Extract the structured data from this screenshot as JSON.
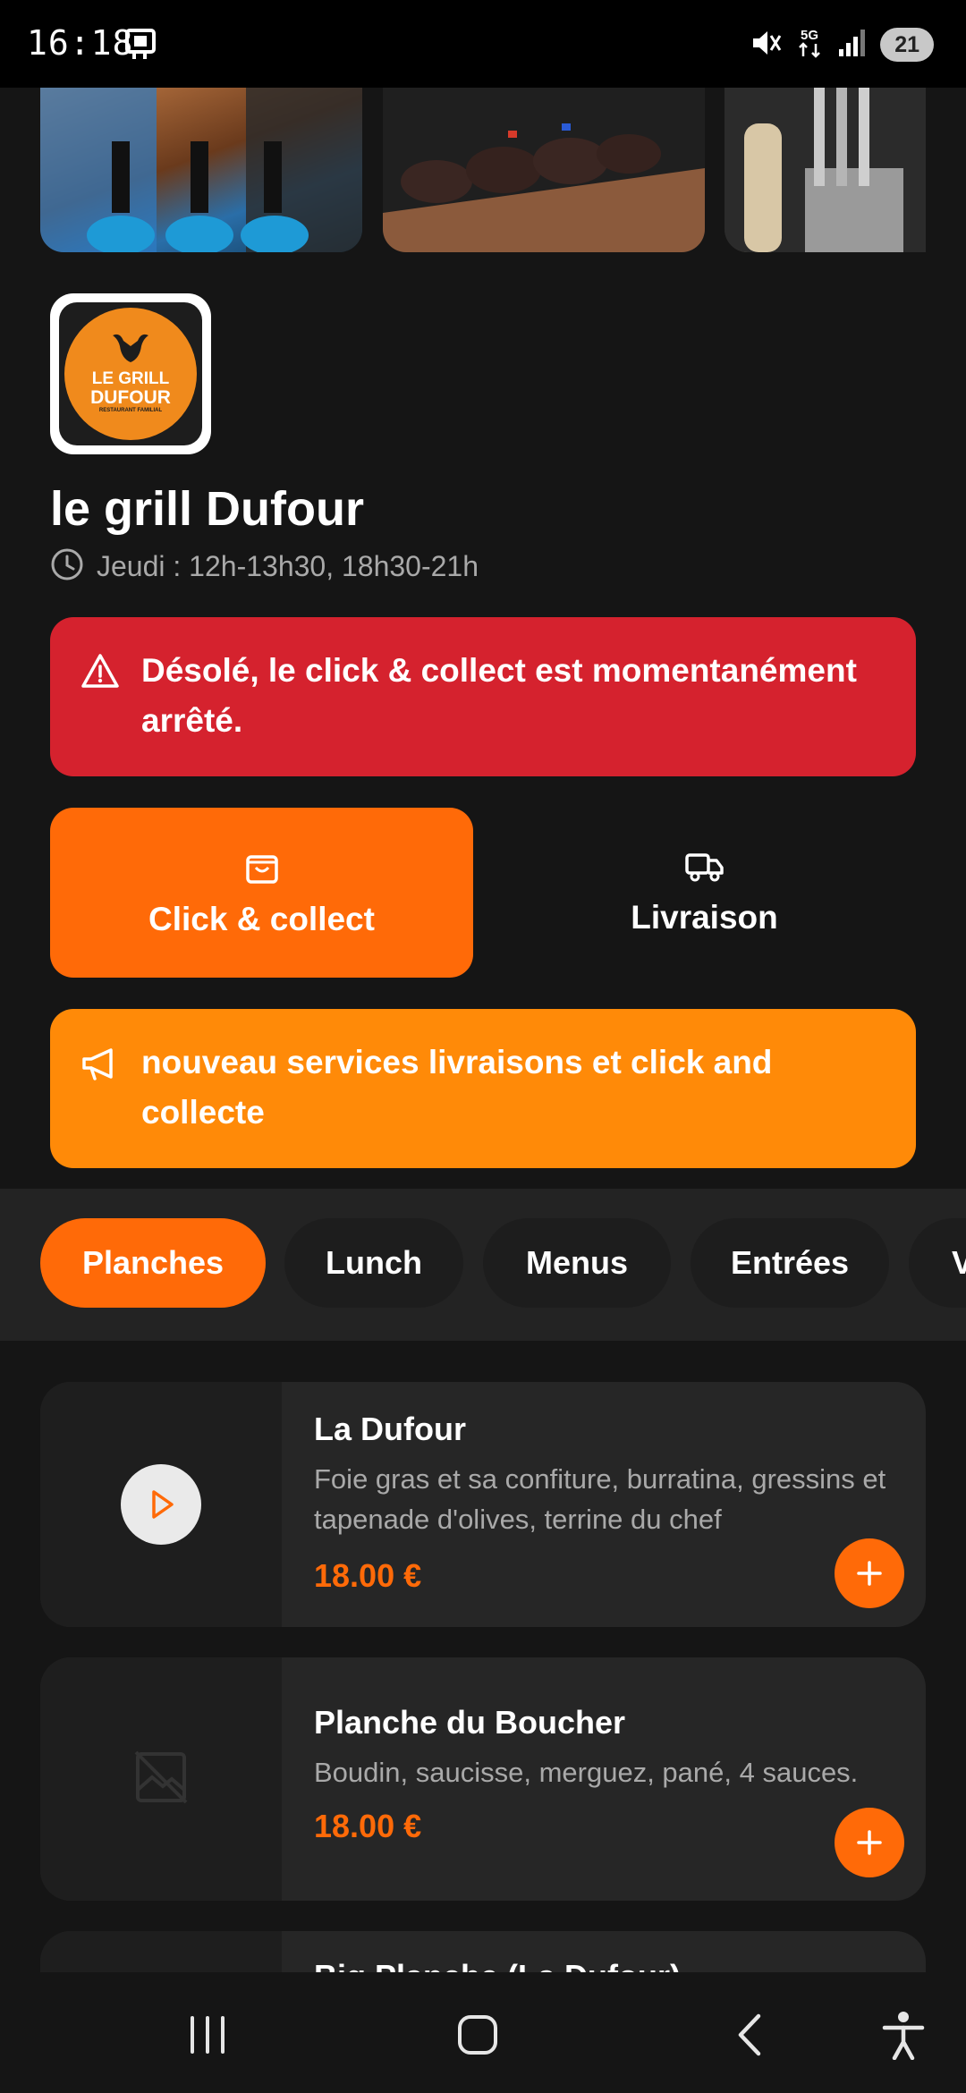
{
  "status_bar": {
    "time": "16:18",
    "network": "5G",
    "battery": "21",
    "icons": [
      "tablet-icon",
      "mute-icon",
      "5g-data-icon",
      "signal-icon",
      "battery-icon"
    ]
  },
  "gallery": {
    "images": [
      "chefs-at-bar-photo",
      "steaks-on-board-photo",
      "kitchen-utensils-photo"
    ]
  },
  "restaurant": {
    "logo_text": "LE GRILL DUFOUR",
    "logo_line1": "LE GRILL",
    "logo_line2": "DUFOUR",
    "logo_line3": "RESTAURANT FAMILIAL",
    "name": "le grill Dufour",
    "hours": "Jeudi : 12h-13h30, 18h30-21h"
  },
  "alert": {
    "text": "Désolé, le click & collect est momentanément arrêté.",
    "color": "#d5222e"
  },
  "modes": {
    "click_collect": "Click & collect",
    "delivery": "Livraison",
    "selected": "Click & collect",
    "accent": "#ff6a08"
  },
  "promo": {
    "text": "nouveau services livraisons et click and collecte",
    "color": "#ff8a08"
  },
  "categories": {
    "items": [
      "Planches",
      "Lunch",
      "Menus",
      "Entrées",
      "V"
    ],
    "selected": "Planches"
  },
  "menu_items": [
    {
      "name": "La Dufour",
      "description": "Foie gras et sa confiture, burratina, gressins et tapenade d'olives, terrine du chef",
      "price": "18.00 €"
    },
    {
      "name": "Planche du Boucher",
      "description": "Boudin, saucisse, merguez, pané, 4 sauces.",
      "price": "18.00 €"
    },
    {
      "name": "Big Planche (La Dufour)"
    }
  ],
  "nav": {
    "buttons": [
      "recent-apps-icon",
      "home-icon",
      "back-icon",
      "accessibility-icon"
    ]
  }
}
